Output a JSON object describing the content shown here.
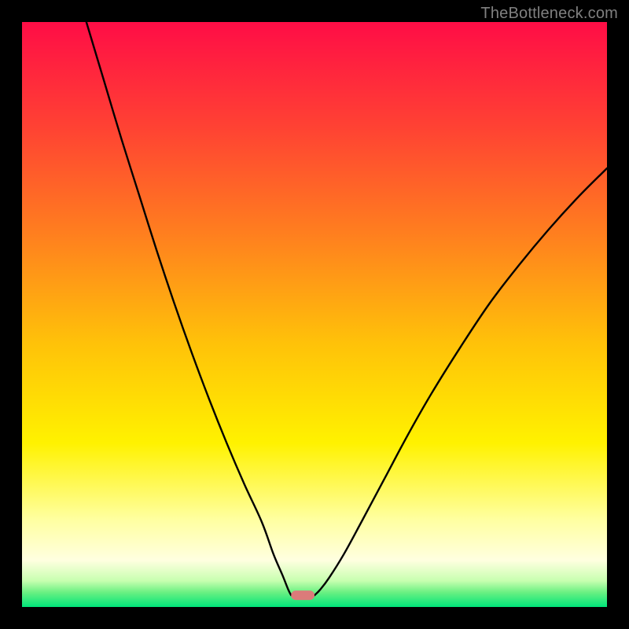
{
  "watermark": "TheBottleneck.com",
  "chart_data": {
    "type": "line",
    "title": "",
    "xlabel": "",
    "ylabel": "",
    "xlim": [
      0,
      100
    ],
    "ylim": [
      0,
      100
    ],
    "grid": false,
    "legend": false,
    "background_gradient_stops": [
      {
        "offset": 0.0,
        "color": "#ff0d46"
      },
      {
        "offset": 0.18,
        "color": "#ff4233"
      },
      {
        "offset": 0.36,
        "color": "#ff7e1f"
      },
      {
        "offset": 0.55,
        "color": "#ffc209"
      },
      {
        "offset": 0.72,
        "color": "#fff200"
      },
      {
        "offset": 0.85,
        "color": "#ffffa0"
      },
      {
        "offset": 0.92,
        "color": "#ffffe0"
      },
      {
        "offset": 0.955,
        "color": "#c8ffb0"
      },
      {
        "offset": 0.975,
        "color": "#6af082"
      },
      {
        "offset": 1.0,
        "color": "#00e57a"
      }
    ],
    "series": [
      {
        "name": "left-curve",
        "color": "#000000",
        "x": [
          11.0,
          14.0,
          17.0,
          20.0,
          23.0,
          26.0,
          29.0,
          32.0,
          35.0,
          38.0,
          41.0,
          43.0,
          44.5,
          45.5,
          46.0
        ],
        "y": [
          100.0,
          90.0,
          80.0,
          70.5,
          61.0,
          52.0,
          43.5,
          35.5,
          28.0,
          21.0,
          14.5,
          9.0,
          5.5,
          3.0,
          2.0
        ]
      },
      {
        "name": "right-curve",
        "color": "#000000",
        "x": [
          50.0,
          51.0,
          52.5,
          55.0,
          58.0,
          62.0,
          66.0,
          70.0,
          75.0,
          80.0,
          85.0,
          90.0,
          95.0,
          100.0
        ],
        "y": [
          2.0,
          3.0,
          5.0,
          9.0,
          14.5,
          22.0,
          29.5,
          36.5,
          44.5,
          52.0,
          58.5,
          64.5,
          70.0,
          75.0
        ]
      }
    ],
    "marker": {
      "name": "bottleneck-marker",
      "color": "#db7b7a",
      "x_center": 48.0,
      "y": 2.0,
      "width_pct": 4.0,
      "height_pct": 1.6
    }
  }
}
